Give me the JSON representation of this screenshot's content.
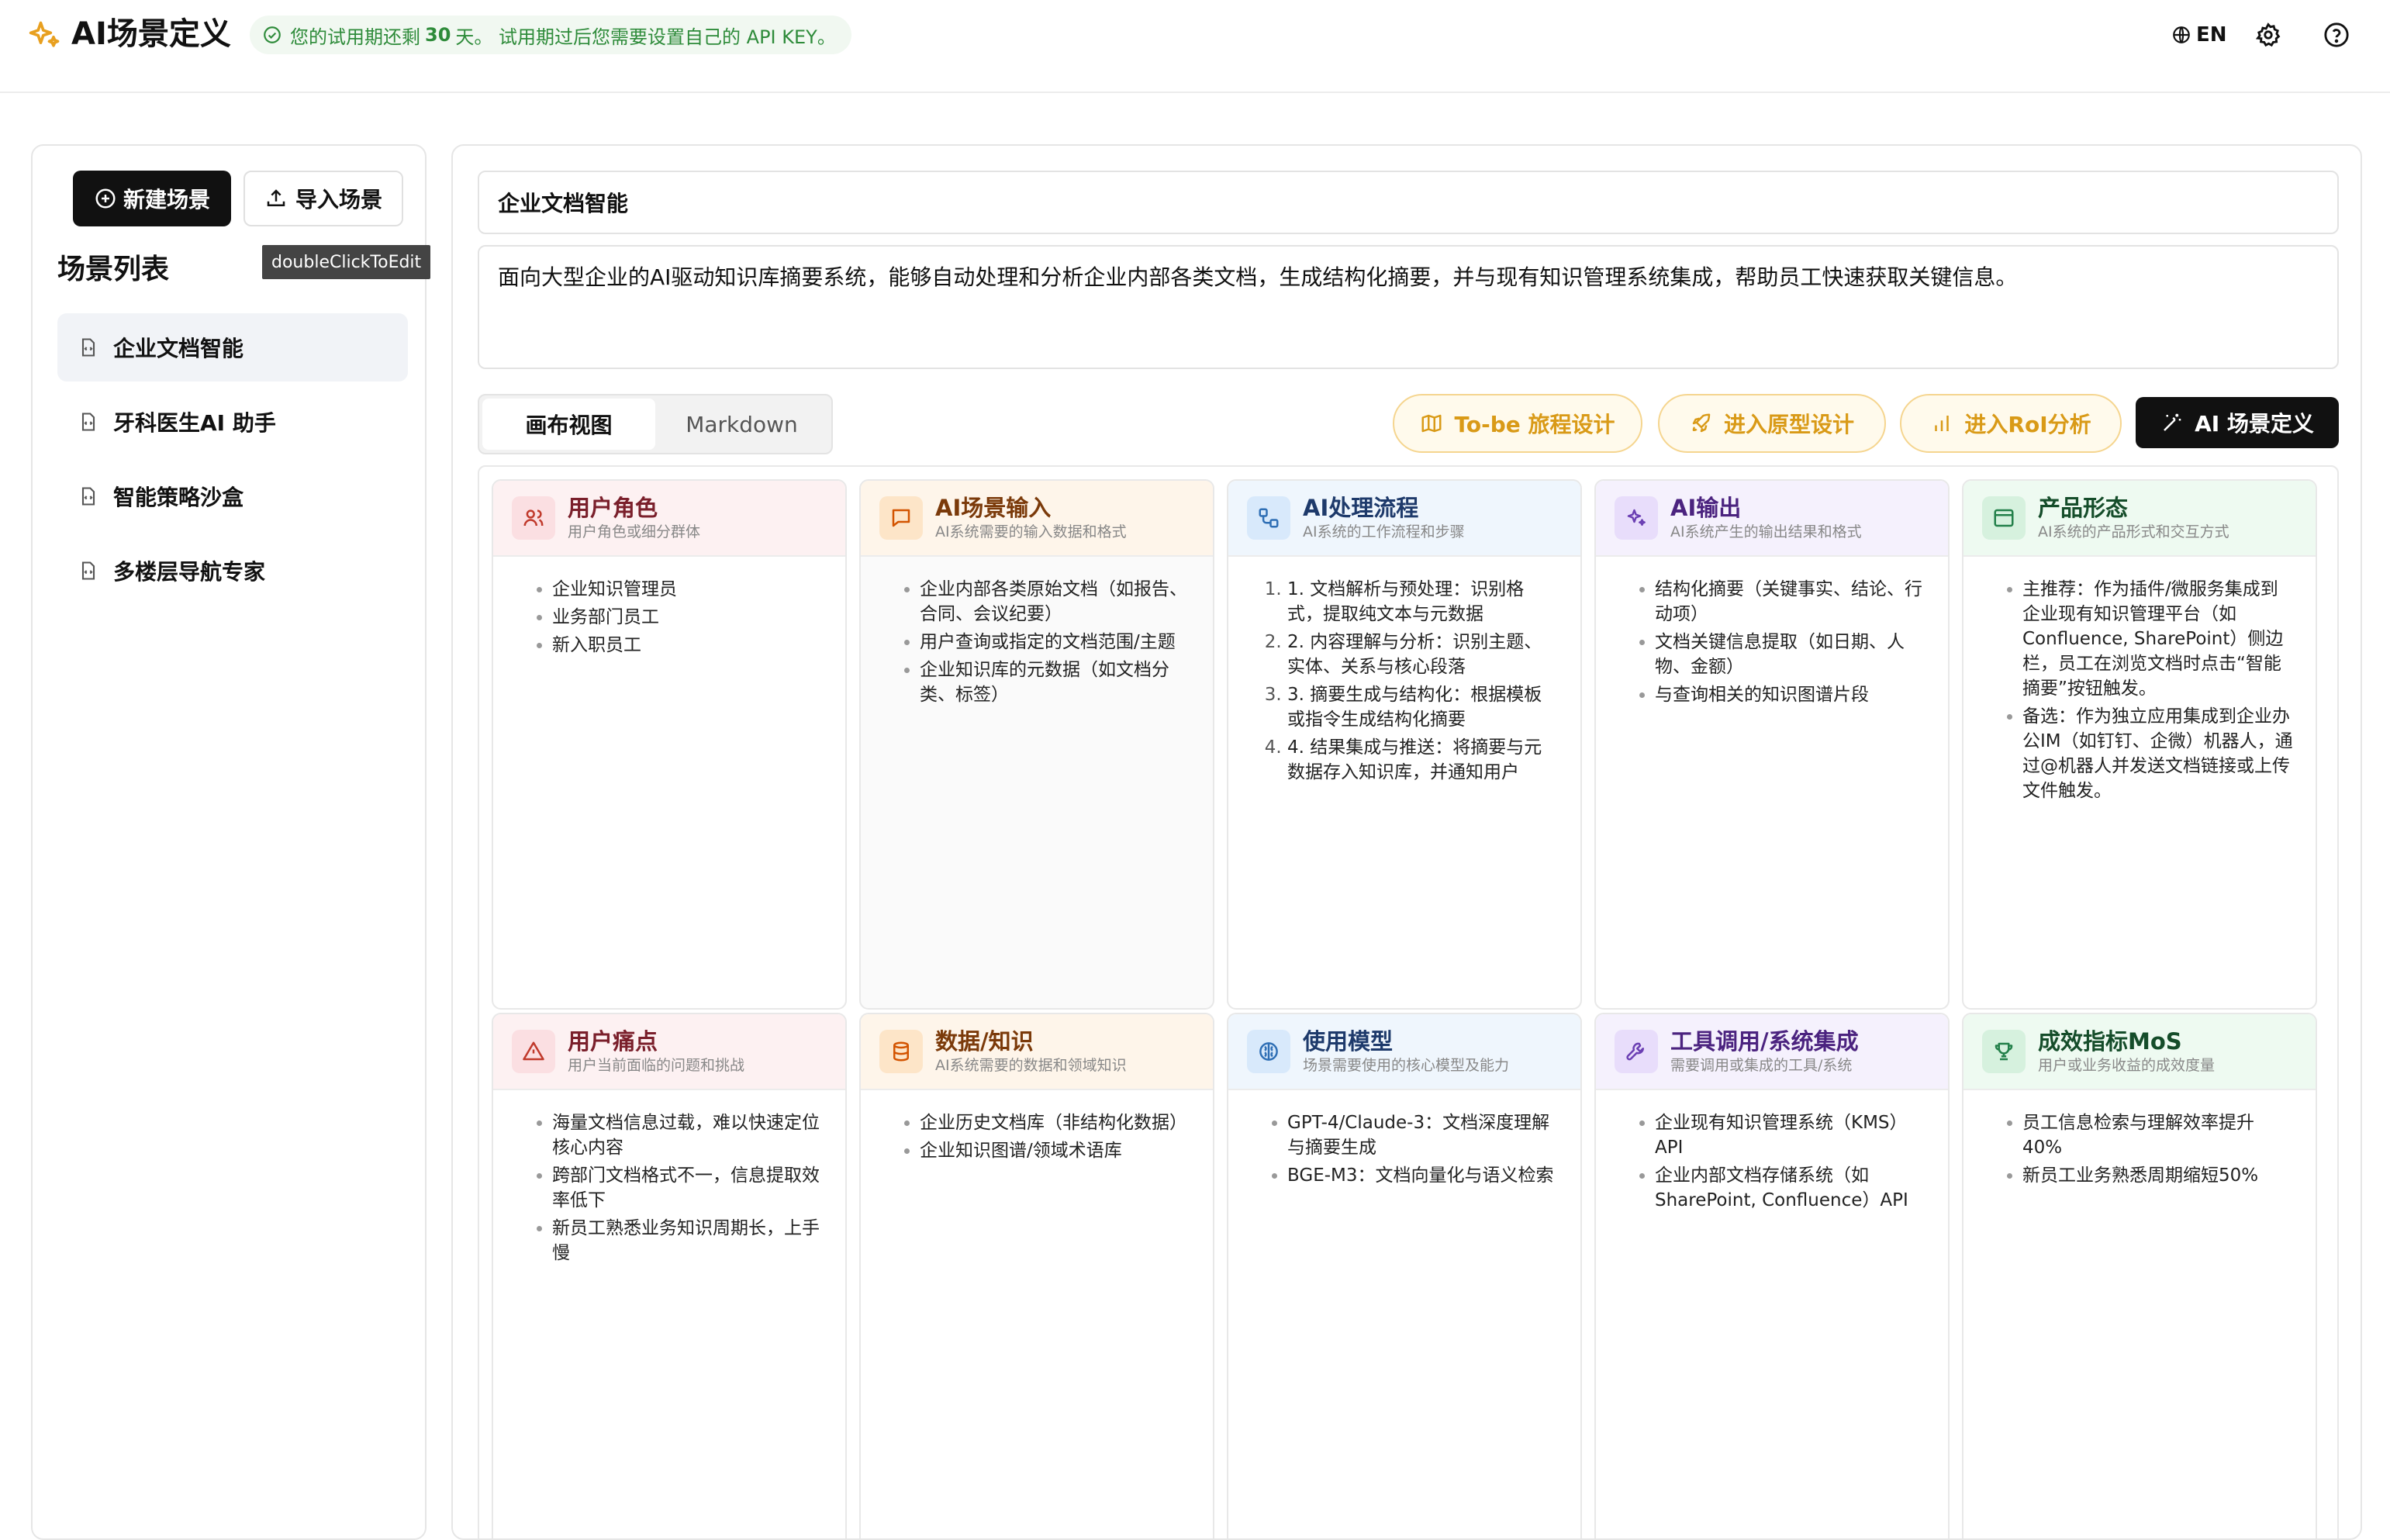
{
  "app": {
    "title": "AI场景定义",
    "trial": {
      "prefix": "您的试用期还剩",
      "days": "30",
      "suffix": "天。 试用期过后您需要设置自己的 API KEY。"
    },
    "lang": "EN",
    "colors": {
      "accent_orange": "#e8a020",
      "trial_green": "#2e8b3a",
      "primary_dark": "#111111"
    }
  },
  "sidebar": {
    "new_label": "新建场景",
    "import_label": "导入场景",
    "list_title": "场景列表",
    "tooltip": "doubleClickToEdit",
    "items": [
      {
        "label": "企业文档智能",
        "active": true
      },
      {
        "label": "牙科医生AI 助手"
      },
      {
        "label": "智能策略沙盒"
      },
      {
        "label": "多楼层导航专家"
      }
    ]
  },
  "scene": {
    "name": "企业文档智能",
    "description": "面向大型企业的AI驱动知识库摘要系统，能够自动处理和分析企业内部各类文档，生成结构化摘要，并与现有知识管理系统集成，帮助员工快速获取关键信息。"
  },
  "toolbar": {
    "view_tabs": [
      "画布视图",
      "Markdown"
    ],
    "journey_label": "To-be 旅程设计",
    "prototype_label": "进入原型设计",
    "roi_label": "进入RoI分析",
    "ai_label": "AI 场景定义"
  },
  "cards": {
    "user_roles": {
      "title": "用户角色",
      "subtitle": "用户角色或细分群体",
      "items": [
        "企业知识管理员",
        "业务部门员工",
        "新入职员工"
      ]
    },
    "ai_input": {
      "title": "AI场景输入",
      "subtitle": "AI系统需要的输入数据和格式",
      "items": [
        "企业内部各类原始文档（如报告、合同、会议纪要）",
        "用户查询或指定的文档范围/主题",
        "企业知识库的元数据（如文档分类、标签）"
      ]
    },
    "ai_process": {
      "title": "AI处理流程",
      "subtitle": "AI系统的工作流程和步骤",
      "items": [
        "1. 文档解析与预处理：识别格式，提取纯文本与元数据",
        "2. 内容理解与分析：识别主题、实体、关系与核心段落",
        "3. 摘要生成与结构化：根据模板或指令生成结构化摘要",
        "4. 结果集成与推送：将摘要与元数据存入知识库，并通知用户"
      ]
    },
    "ai_output": {
      "title": "AI输出",
      "subtitle": "AI系统产生的输出结果和格式",
      "items": [
        "结构化摘要（关键事实、结论、行动项）",
        "文档关键信息提取（如日期、人物、金额）",
        "与查询相关的知识图谱片段"
      ]
    },
    "product_form": {
      "title": "产品形态",
      "subtitle": "AI系统的产品形式和交互方式",
      "items": [
        "主推荐：作为插件/微服务集成到企业现有知识管理平台（如Confluence, SharePoint）侧边栏，员工在浏览文档时点击“智能摘要”按钮触发。",
        "备选：作为独立应用集成到企业办公IM（如钉钉、企微）机器人，通过@机器人并发送文档链接或上传文件触发。"
      ]
    },
    "pain_points": {
      "title": "用户痛点",
      "subtitle": "用户当前面临的问题和挑战",
      "items": [
        "海量文档信息过载，难以快速定位核心内容",
        "跨部门文档格式不一，信息提取效率低下",
        "新员工熟悉业务知识周期长，上手慢"
      ]
    },
    "data_knowledge": {
      "title": "数据/知识",
      "subtitle": "AI系统需要的数据和领域知识",
      "items": [
        "企业历史文档库（非结构化数据）",
        "企业知识图谱/领域术语库"
      ]
    },
    "models": {
      "title": "使用模型",
      "subtitle": "场景需要使用的核心模型及能力",
      "items": [
        "GPT-4/Claude-3：文档深度理解与摘要生成",
        "BGE-M3：文档向量化与语义检索"
      ]
    },
    "tools": {
      "title": "工具调用/系统集成",
      "subtitle": "需要调用或集成的工具/系统",
      "items": [
        "企业现有知识管理系统（KMS）API",
        "企业内部文档存储系统（如SharePoint, Confluence）API"
      ]
    },
    "metrics": {
      "title": "成效指标MoS",
      "subtitle": "用户或业务收益的成效度量",
      "items": [
        "员工信息检索与理解效率提升40%",
        "新员工业务熟悉周期缩短50%"
      ]
    }
  }
}
